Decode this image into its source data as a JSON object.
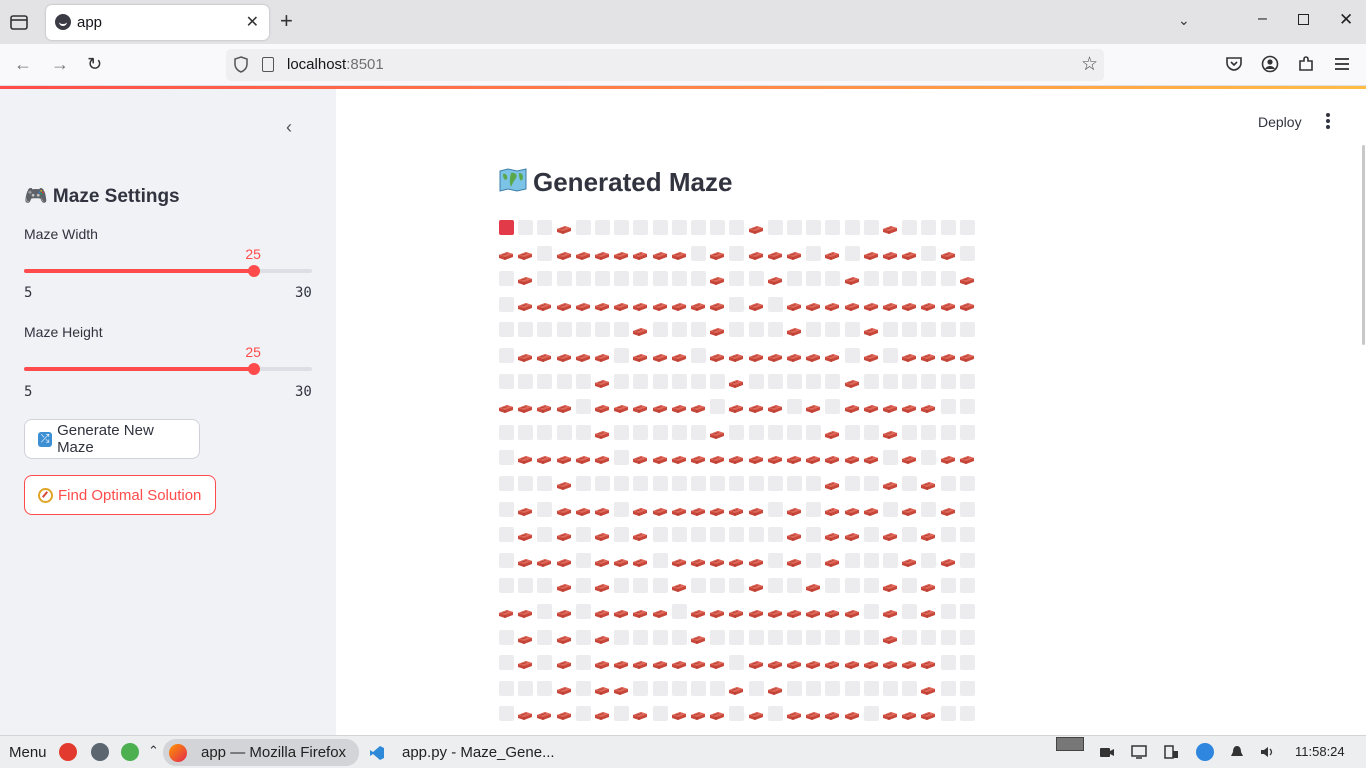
{
  "browser": {
    "tab_title": "app",
    "url_host": "localhost",
    "url_port": ":8501"
  },
  "sidebar": {
    "title": "🎮 Maze Settings",
    "sliders": [
      {
        "label": "Maze Width",
        "value": "25",
        "min": "5",
        "max": "30",
        "fraction": 0.8
      },
      {
        "label": "Maze Height",
        "value": "25",
        "min": "5",
        "max": "30",
        "fraction": 0.8
      }
    ],
    "generate_button": "Generate New Maze",
    "find_button": "Find Optimal Solution"
  },
  "main": {
    "deploy": "Deploy",
    "title": "Generated Maze",
    "maze_rows": [
      "SooBoooooooooBooooooBoooooo",
      "BBoBBBBBBBoBoBBBoBoBBBoBoBo",
      "oBoooooooooBooBoooBoooooBoo",
      "oBBBBBBBBBBBoBoBBBBBBBBBBoo",
      "oooooooBoooBoooBoooBooooooo",
      "oBBBBBoBBBoBBBBBBBoBoBBBBoo",
      "oooooBooooooBoooooBoooooooo",
      "BBBBoBBBBBBoBBBoBoBBBBBoooo",
      "oooooBoooooBoooooBooBoooooo",
      "oBBBBBoBBBBBBBBBBBBBoBoBBoo",
      "oooBoooooooooooooBooBoBoooo",
      "oBoBBBoBBBBBBBoBoBBBoBoBooo",
      "oBoBoBoBoooooooBoBBoBoBoooo",
      "oBBBoBBBoBBBBBoBoBoooBoBooo",
      "oooBoBoooBoooBooBoooBoBoooo",
      "BBoBoBBBBoBBBBBBBBBoBoBoooo",
      "oBoBoBooooBoooooooooBoooooo",
      "oBoBoBBBBBBBoBBBBBBBBBBoooo",
      "oooBoBBoooooBoBoooooooBoooo",
      "oBBBoBoBoBBBoBoBBBBoBBBoooo"
    ],
    "cols": 25
  },
  "taskbar": {
    "menu": "Menu",
    "firefox": "app — Mozilla Firefox",
    "vscode": "app.py - Maze_Gene...",
    "clock": "11:58:24"
  }
}
